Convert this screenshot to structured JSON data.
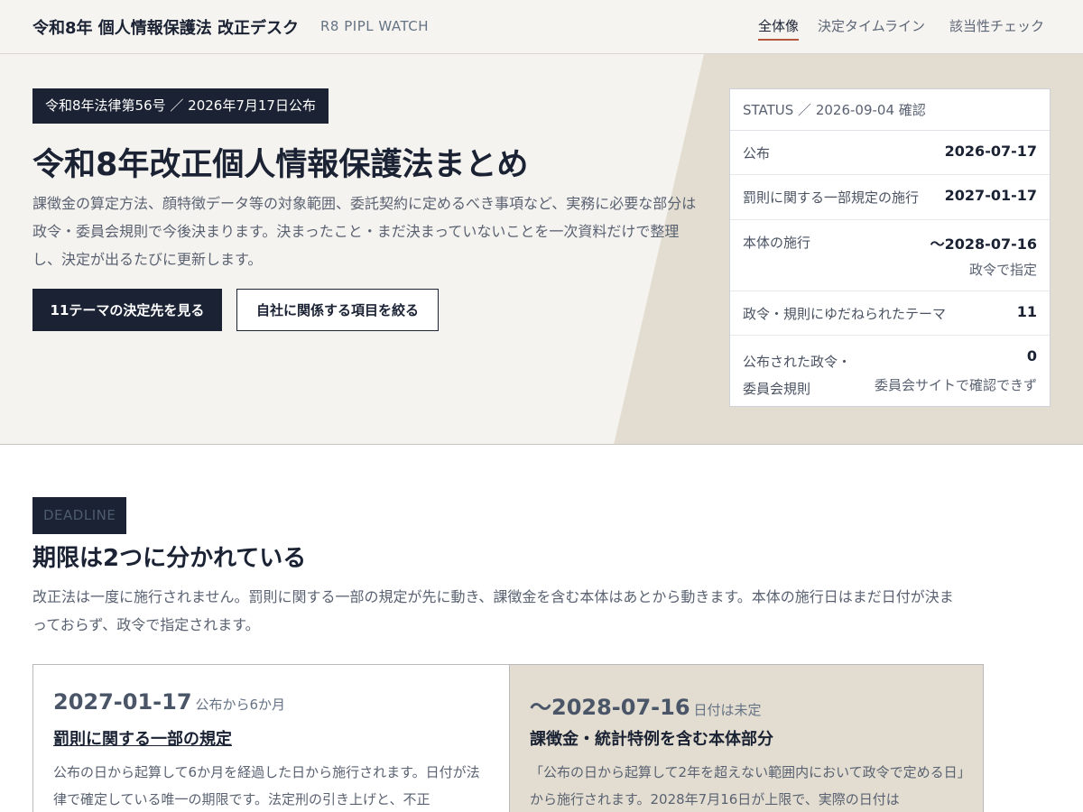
{
  "header": {
    "brand": "令和8年 個人情報保護法 改正デスク",
    "brand_sub": "R8 PIPL WATCH",
    "nav": [
      "全体像",
      "決定タイムライン",
      "該当性チェック"
    ],
    "active_nav": "全体像"
  },
  "hero": {
    "badge": "令和8年法律第56号 ／ 2026年7月17日公布",
    "title": "令和8年改正個人情報保護法まとめ",
    "description": "課徴金の算定方法、顔特徴データ等の対象範囲、委託契約に定めるべき事項など、実務に必要な部分は政令・委員会規則で今後決まります。決まったこと・まだ決まっていないことを一次資料だけで整理し、決定が出るたびに更新します。",
    "primary_button": "11テーマの決定先を見る",
    "secondary_button": "自社に関係する項目を絞る"
  },
  "status": {
    "heading": "STATUS ／ 2026-09-04 確認",
    "rows": [
      {
        "label": "公布",
        "value": "2026-07-17",
        "note": ""
      },
      {
        "label": "罰則に関する一部規定の施行",
        "value": "2027-01-17",
        "note": ""
      },
      {
        "label": "本体の施行",
        "value": "〜2028-07-16",
        "note": "政令で指定"
      },
      {
        "label": "政令・規則にゆだねられたテーマ",
        "value": "11",
        "note": ""
      },
      {
        "label": "公布された政令・委員会規則",
        "value": "0",
        "note": "委員会サイトで確認できず"
      }
    ]
  },
  "deadline": {
    "badge": "DEADLINE",
    "title": "期限は2つに分かれている",
    "description": "改正法は一度に施行されません。罰則に関する一部の規定が先に動き、課徴金を含む本体はあとから動きます。本体の施行日はまだ日付が決まっておらず、政令で指定されます。",
    "cards": [
      {
        "date": "2027-01-17",
        "date_note": "公布から6か月",
        "heading": "罰則に関する一部の規定",
        "text": "公布の日から起算して6か月を経過した日から施行されます。日付が法律で確定している唯一の期限です。法定刑の引き上げと、不正"
      },
      {
        "date": "〜2028-07-16",
        "date_note": "日付は未定",
        "heading": "課徴金・統計特例を含む本体部分",
        "text": "「公布の日から起算して2年を超えない範囲内において政令で定める日」から施行されます。2028年7月16日が上限で、実際の日付は"
      }
    ]
  },
  "colors": {
    "navy": "#1a2233",
    "accent_underline": "#b5573c",
    "hero_bg": "#f5f3ef",
    "hero_shape": "#e2ddd0"
  }
}
